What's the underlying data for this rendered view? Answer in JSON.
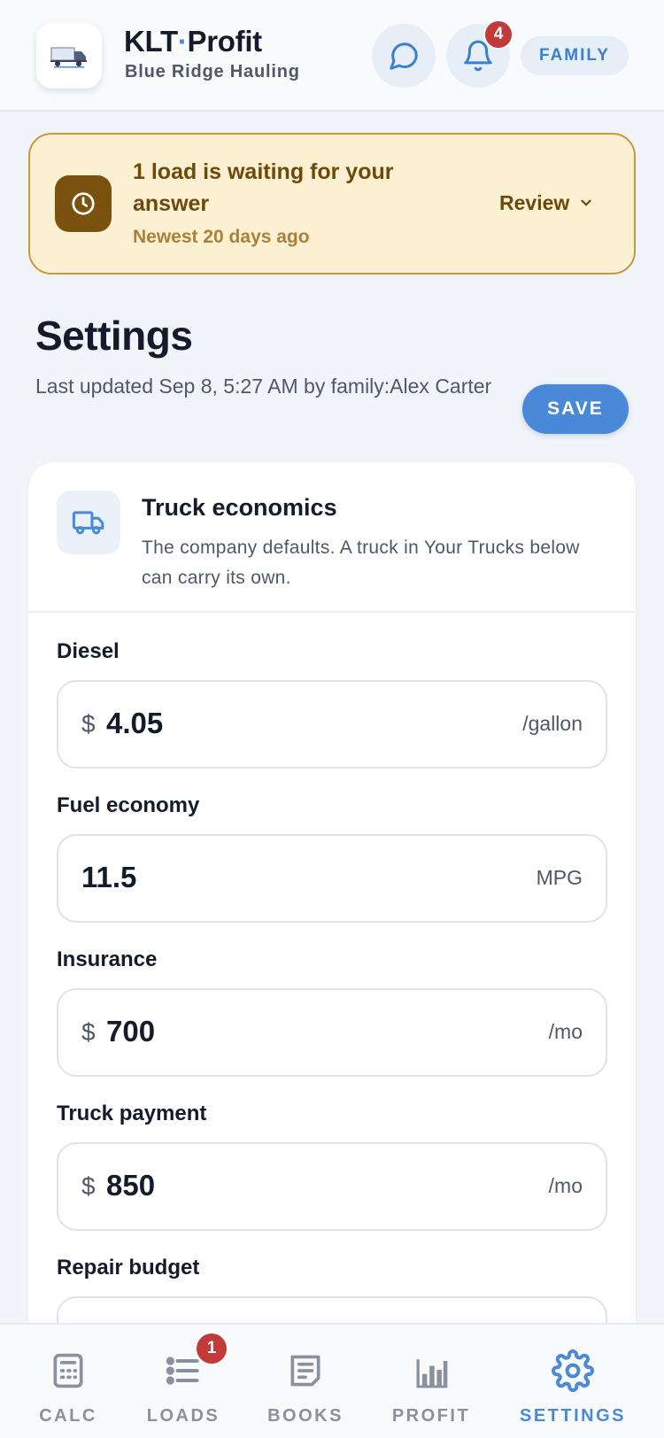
{
  "header": {
    "app_name_left": "KLT",
    "app_name_dot": "·",
    "app_name_right": "Profit",
    "company": "Blue Ridge Hauling",
    "notification_count": "4",
    "role": "FAMILY"
  },
  "alert": {
    "title": "1 load is waiting for your answer",
    "subtitle": "Newest 20 days ago",
    "action": "Review"
  },
  "page": {
    "title": "Settings",
    "updated": "Last updated Sep 8, 5:27 AM by family:Alex Carter",
    "save_label": "SAVE"
  },
  "card": {
    "title": "Truck economics",
    "description": "The company defaults. A truck in Your Trucks below can carry its own.",
    "fields": [
      {
        "label": "Diesel",
        "prefix": "$",
        "value": "4.05",
        "unit": "/gallon"
      },
      {
        "label": "Fuel economy",
        "prefix": "",
        "value": "11.5",
        "unit": "MPG"
      },
      {
        "label": "Insurance",
        "prefix": "$",
        "value": "700",
        "unit": "/mo"
      },
      {
        "label": "Truck payment",
        "prefix": "$",
        "value": "850",
        "unit": "/mo"
      },
      {
        "label": "Repair budget",
        "prefix": "",
        "value": "",
        "unit": ""
      }
    ]
  },
  "nav": {
    "items": [
      {
        "label": "CALC"
      },
      {
        "label": "LOADS"
      },
      {
        "label": "BOOKS"
      },
      {
        "label": "PROFIT"
      },
      {
        "label": "SETTINGS"
      }
    ],
    "loads_badge": "1"
  },
  "colors": {
    "accent": "#4a88d8",
    "alert_bg": "#fcf0d2",
    "alert_text": "#6d4a0c",
    "badge": "#c23a3a"
  }
}
